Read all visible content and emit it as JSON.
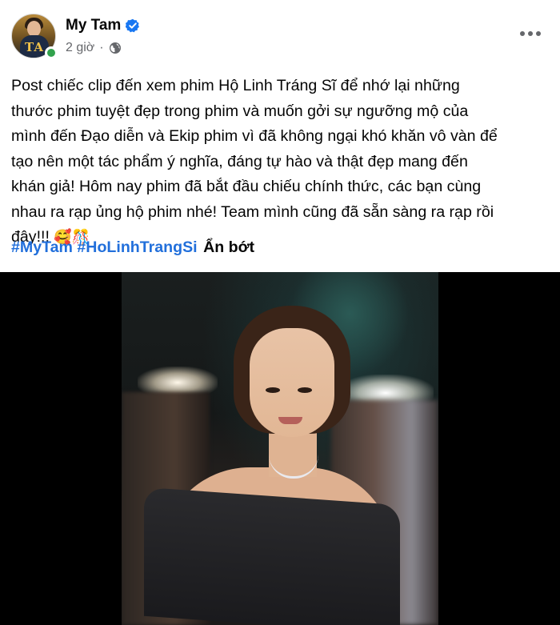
{
  "post": {
    "author": "My Tam",
    "avatar_text": "TA",
    "time": "2 giờ",
    "separator": "·",
    "text_lines": [
      "Post chiếc clip đến xem phim Hộ Linh Tráng Sĩ để nhớ lại những",
      "thước phim tuyệt đẹp trong phim và muốn gởi sự ngưỡng mộ của",
      "mình đến Đạo diễn và Ekip phim vì đã không ngại khó khăn vô vàn để",
      "tạo nên một tác phẩm ý nghĩa, đáng tự hào và thật đẹp mang đến",
      "khán giả! Hôm nay phim đã bắt đầu chiếu chính thức, các bạn cùng",
      "nhau ra rạp ủng hộ phim nhé! Team mình cũng đã sẵn sàng ra rạp rồi",
      "đây!!!"
    ],
    "emojis": "🥰🎊",
    "hashtags": [
      "#MyTam",
      "#HoLinhTrangSi"
    ],
    "see_less": "Ẩn bớt"
  },
  "colors": {
    "text": "#050505",
    "secondary": "#65676b",
    "link": "#216fdb",
    "verified": "#1877f2",
    "online": "#31a24c"
  },
  "icons": {
    "verified": "verified-badge-icon",
    "privacy": "globe-icon",
    "menu": "more-options-icon"
  }
}
